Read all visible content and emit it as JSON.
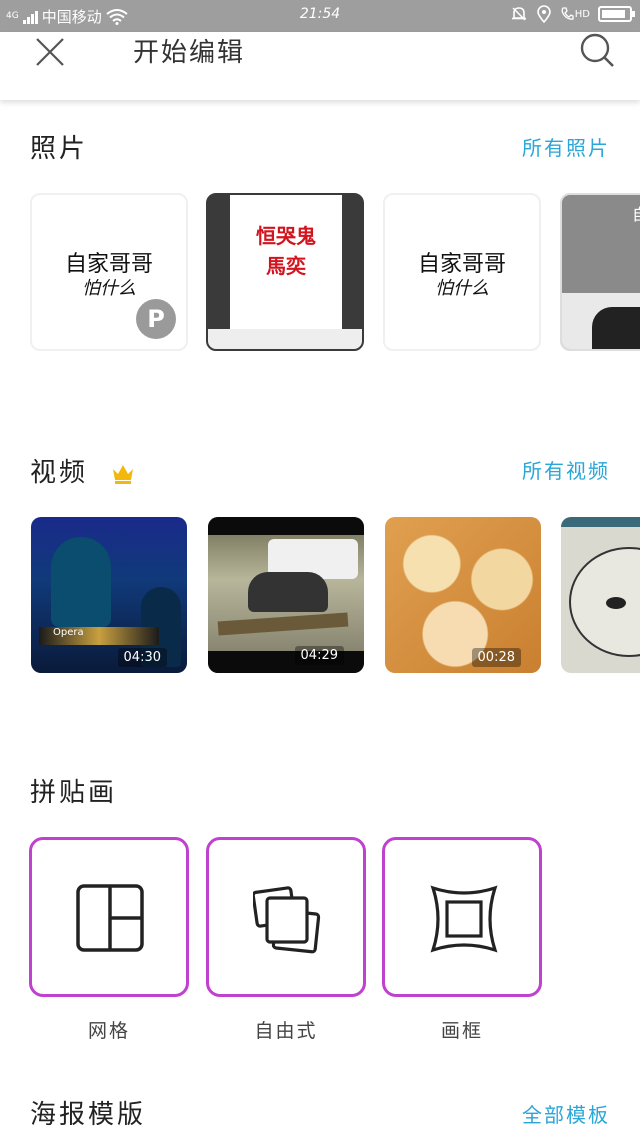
{
  "status_bar": {
    "network": "4G",
    "carrier": "中国移动",
    "time": "21:54",
    "hd_label": "HD",
    "battery_level": 0.9,
    "icons": [
      "wifi-icon",
      "alarm-icon",
      "location-icon",
      "call-hd-icon",
      "battery-icon"
    ]
  },
  "header": {
    "title": "开始编辑",
    "close_icon": "close-icon",
    "search_icon": "search-icon"
  },
  "photos": {
    "title": "照片",
    "link": "所有照片",
    "items": [
      {
        "line1": "自家哥哥",
        "line2": "怕什么",
        "badge": "P"
      },
      {
        "line1": "恒哭鬼",
        "line2": "馬奕"
      },
      {
        "line1": "自家哥哥",
        "line2": "怕什么"
      },
      {
        "partial_text": "自"
      }
    ]
  },
  "videos": {
    "title": "视频",
    "crown_icon": "crown-icon",
    "link": "所有视频",
    "items": [
      {
        "duration": "04:30",
        "scene": "Opera"
      },
      {
        "duration": "04:29"
      },
      {
        "duration": "00:28"
      },
      {}
    ]
  },
  "collage": {
    "title": "拼贴画",
    "items": [
      {
        "label": "网格",
        "icon": "grid-layout-icon"
      },
      {
        "label": "自由式",
        "icon": "freestyle-icon"
      },
      {
        "label": "画框",
        "icon": "frame-icon"
      }
    ]
  },
  "posters": {
    "title": "海报模版",
    "link": "全部模板"
  },
  "colors": {
    "status_bar": "#9e9e9e",
    "link": "#2aa6d9",
    "collage_border": "#c040d0",
    "crown": "#f2b90c"
  }
}
